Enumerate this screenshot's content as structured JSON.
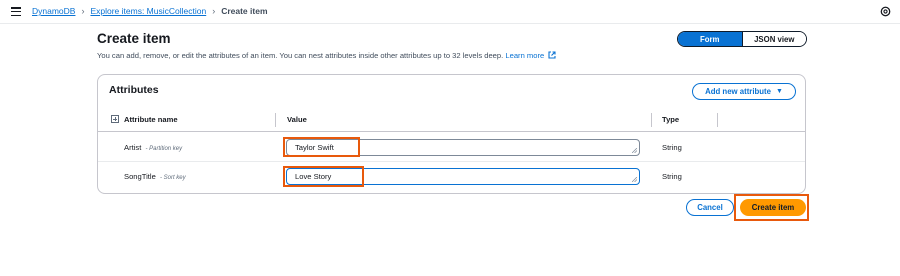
{
  "breadcrumbs": {
    "items": [
      "DynamoDB",
      "Explore items: MusicCollection"
    ],
    "current": "Create item"
  },
  "page": {
    "title": "Create item",
    "description": "You can add, remove, or edit the attributes of an item. You can nest attributes inside other attributes up to 32 levels deep.",
    "learn_more": "Learn more"
  },
  "view_toggle": {
    "options": [
      "Form",
      "JSON view"
    ],
    "selected": "Form"
  },
  "attributes": {
    "title": "Attributes",
    "add_button": "Add new attribute",
    "columns": {
      "name": "Attribute name",
      "value": "Value",
      "type": "Type"
    },
    "rows": [
      {
        "name": "Artist",
        "key_label": "- Partition key",
        "value": "Taylor Swift",
        "type": "String"
      },
      {
        "name": "SongTitle",
        "key_label": "- Sort key",
        "value": "Love Story",
        "type": "String"
      }
    ]
  },
  "footer": {
    "cancel": "Cancel",
    "create": "Create item"
  },
  "colors": {
    "accent": "#0972d3",
    "primary_button": "#ff9900",
    "highlight": "#e8590c"
  }
}
